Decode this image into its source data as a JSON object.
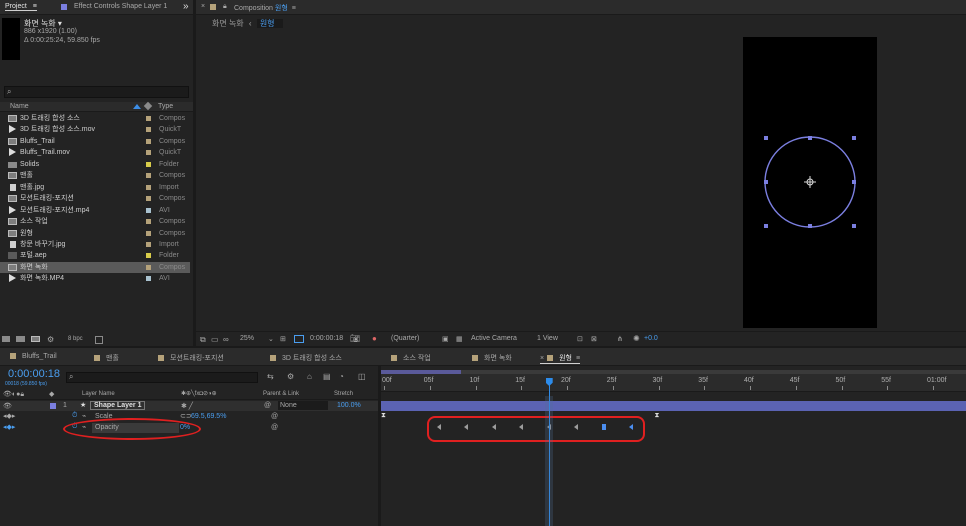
{
  "project": {
    "tab_label": "Project",
    "menu_glyph": "≡",
    "effect_controls_label": "Effect Controls Shape Layer 1",
    "overflow_glyph": "»",
    "preview": {
      "name": "화면 녹화 ▾",
      "resolution": "886 x1920 (1.00)",
      "duration": "Δ 0:00:25:24, 59.850 fps"
    },
    "search_glyph": "⌕",
    "columns": {
      "name": "Name",
      "type": "Type"
    },
    "items": [
      {
        "name": "3D 트래킹 합성 소스",
        "type": "Compos",
        "icon": "comp-icon",
        "label_color": "#b5a27a"
      },
      {
        "name": "3D 트래킹 합성 소스.mov",
        "type": "QuickT",
        "icon": "video-icon",
        "label_color": "#b5a27a"
      },
      {
        "name": "Bluffs_Trail",
        "type": "Compos",
        "icon": "comp-icon",
        "label_color": "#b5a27a"
      },
      {
        "name": "Bluffs_Trail.mov",
        "type": "QuickT",
        "icon": "video-icon",
        "label_color": "#b5a27a"
      },
      {
        "name": "Solids",
        "type": "Folder",
        "icon": "folder-icon",
        "label_color": "#d8cc4a"
      },
      {
        "name": "맨홀",
        "type": "Compos",
        "icon": "comp-icon",
        "label_color": "#b5a27a"
      },
      {
        "name": "맨홀.jpg",
        "type": "Import",
        "icon": "image-icon",
        "label_color": "#b5a27a"
      },
      {
        "name": "모션트래킹-포지션",
        "type": "Compos",
        "icon": "comp-icon",
        "label_color": "#b5a27a"
      },
      {
        "name": "모션트래킹-포지션.mp4",
        "type": "AVI",
        "icon": "video-icon",
        "label_color": "#a9c2cf"
      },
      {
        "name": "소스 작업",
        "type": "Compos",
        "icon": "comp-icon",
        "label_color": "#b5a27a"
      },
      {
        "name": "원형",
        "type": "Compos",
        "icon": "comp-icon",
        "label_color": "#b5a27a"
      },
      {
        "name": "창문 바꾸기.jpg",
        "type": "Import",
        "icon": "image-icon",
        "label_color": "#b5a27a"
      },
      {
        "name": "포털.aep",
        "type": "Folder",
        "icon": "aep-icon",
        "label_color": "#d8cc4a"
      },
      {
        "name": "화면 녹화",
        "type": "Compos",
        "icon": "comp-icon",
        "label_color": "#b5a27a",
        "selected": true
      },
      {
        "name": "화면 녹화.MP4",
        "type": "AVI",
        "icon": "video-icon",
        "label_color": "#a9c2cf"
      }
    ],
    "bpc": "8 bpc"
  },
  "composition": {
    "panel_label": "Composition",
    "comp_name": "원형",
    "menu_glyph": "≡",
    "breadcrumbs": [
      "화면 녹화",
      "원형"
    ],
    "breadcrumb_sep": "‹",
    "toolbar": {
      "zoom": "25%",
      "timecode": "0:00:00:18",
      "resolution": "(Quarter)",
      "camera": "Active Camera",
      "view": "1 View",
      "exposure": "+0.0"
    }
  },
  "timeline": {
    "tabs": [
      {
        "label": "Bluffs_Trail",
        "color": "#b5a27a"
      },
      {
        "label": "맨홀",
        "color": "#b5a27a"
      },
      {
        "label": "모션트래킹-포지션",
        "color": "#b5a27a"
      },
      {
        "label": "3D 트래킹 합성 소스",
        "color": "#b5a27a"
      },
      {
        "label": "소스 작업",
        "color": "#b5a27a"
      },
      {
        "label": "화면 녹화",
        "color": "#b5a27a"
      },
      {
        "label": "원형",
        "color": "#b5a27a",
        "active": true
      }
    ],
    "close_glyph": "×",
    "menu_glyph": "≡",
    "current_time": "0:00:00:18",
    "frame_info": "00018 (59.850 fps)",
    "search_glyph": "⌕",
    "column_headers": {
      "layer_name": "Layer Name",
      "parent": "Parent & Link",
      "stretch": "Stretch"
    },
    "layer": {
      "number": "1",
      "name": "Shape Layer 1",
      "parent": "None",
      "stretch": "100.0%"
    },
    "properties": [
      {
        "name": "Scale",
        "value": "69.5,69.5%"
      },
      {
        "name": "Opacity",
        "value": "0%"
      }
    ],
    "ruler_ticks": [
      "00f",
      "05f",
      "10f",
      "15f",
      "20f",
      "25f",
      "30f",
      "35f",
      "40f",
      "45f",
      "50f",
      "55f",
      "01:00f"
    ],
    "playhead_frame": 18,
    "opacity_keyframes_frames": [
      6,
      9,
      12,
      15,
      18,
      21,
      24,
      27
    ],
    "accent_color": "#2d8ceb",
    "shape_color": "#7b7fe0",
    "annotation_color": "#e02020"
  }
}
